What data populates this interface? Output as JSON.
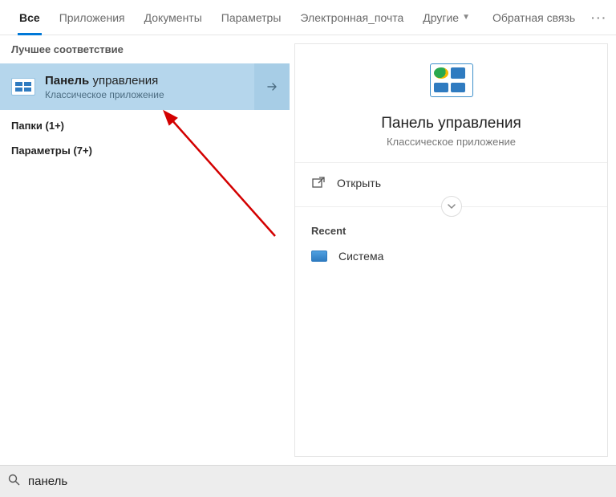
{
  "tabs": {
    "all": "Все",
    "apps": "Приложения",
    "docs": "Документы",
    "settings": "Параметры",
    "email": "Электронная_почта",
    "other": "Другие",
    "feedback": "Обратная связь"
  },
  "left": {
    "bestHeader": "Лучшее соответствие",
    "bestTitleBold": "Панель",
    "bestTitleRest": " управления",
    "bestSub": "Классическое приложение",
    "folders": "Папки (1+)",
    "params": "Параметры (7+)"
  },
  "detail": {
    "title": "Панель управления",
    "sub": "Классическое приложение",
    "open": "Открыть",
    "recentHeader": "Recent",
    "recentItem": "Система"
  },
  "search": {
    "value": "панель"
  }
}
